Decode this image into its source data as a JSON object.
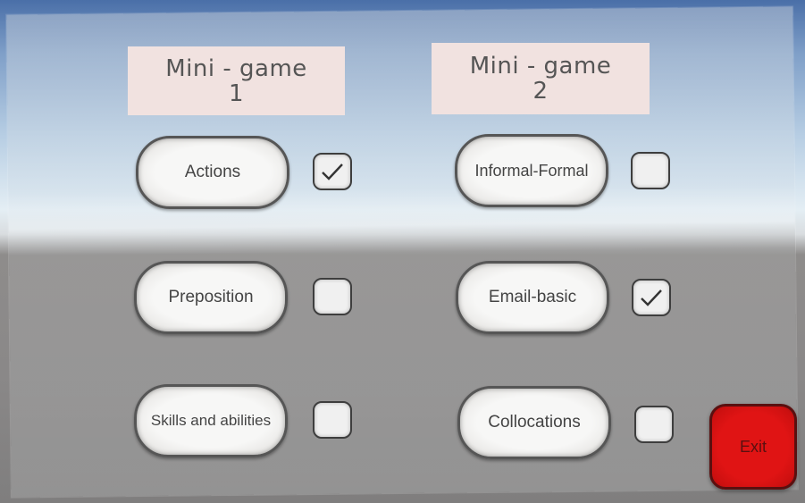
{
  "columns": [
    {
      "header": "Mini - game\n1",
      "items": [
        {
          "label": "Actions",
          "checked": true
        },
        {
          "label": "Preposition",
          "checked": false
        },
        {
          "label": "Skills and abilities",
          "checked": false
        }
      ]
    },
    {
      "header": "Mini - game\n2",
      "items": [
        {
          "label": "Informal-Formal",
          "checked": false
        },
        {
          "label": "Email-basic",
          "checked": true
        },
        {
          "label": "Collocations",
          "checked": false
        }
      ]
    }
  ],
  "exit_label": "Exit",
  "colors": {
    "header_bg": "#f1e2e0",
    "exit_red": "#e01414",
    "button_face": "#f7f7f6",
    "outline": "#565656"
  }
}
